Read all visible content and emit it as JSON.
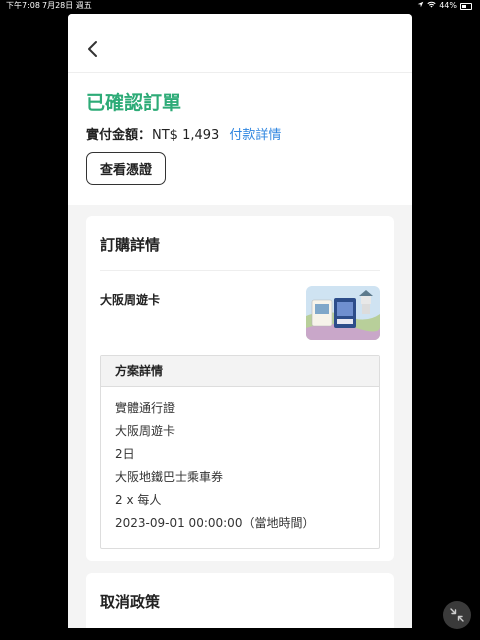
{
  "status_bar": {
    "time": "下午7:08",
    "date": "7月28日 週五",
    "battery": "44%"
  },
  "header": {
    "back_icon": "chevron-left-icon"
  },
  "order": {
    "status": "已確認訂單",
    "amount_label": "實付金額：",
    "amount_value": "NT$ 1,493",
    "payment_details_link": "付款詳情",
    "voucher_button": "查看憑證"
  },
  "details_card": {
    "title": "訂購詳情",
    "product_name": "大阪周遊卡",
    "plan": {
      "header": "方案詳情",
      "items": [
        "實體通行證",
        "大阪周遊卡",
        "2日",
        "大阪地鐵巴士乘車券",
        "2 x 每人",
        "2023-09-01 00:00:00（當地時間）"
      ]
    }
  },
  "cancel_card": {
    "title": "取消政策"
  },
  "colors": {
    "accent_green": "#2dab77",
    "link_blue": "#2f86e0"
  }
}
